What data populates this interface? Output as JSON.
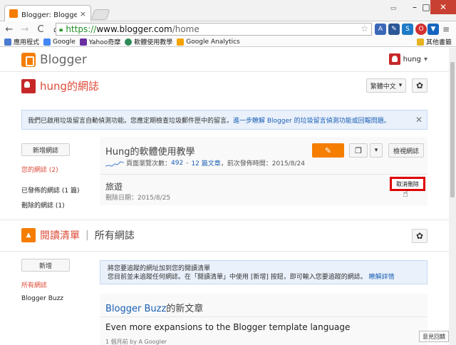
{
  "browser": {
    "tab_title": "Blogger: Blogger 資訊主",
    "tab_close": "×",
    "window_min": "–",
    "window_max": "□",
    "window_close": "✕",
    "back": "←",
    "forward": "→",
    "reload": "C",
    "home": "⌂",
    "url_scheme": "https://",
    "url_host": "www.blogger.com",
    "url_path": "/home",
    "bookmarks": [
      {
        "label": "應用程式",
        "color": "#4a7bd0"
      },
      {
        "label": "Google",
        "color": "#4285f4"
      },
      {
        "label": "Yahoo奇摩",
        "color": "#6b2fa0"
      },
      {
        "label": "軟體使用教學",
        "color": "#2e8b57"
      },
      {
        "label": "Google Analytics",
        "color": "#f4a300"
      }
    ],
    "other_bookmarks": "其他書籤"
  },
  "header": {
    "brand": "Blogger",
    "user": "hung",
    "user_caret": "▾"
  },
  "page": {
    "title": "hung的網誌",
    "lang_button": "繁體中文",
    "lang_caret": "▾",
    "gear": "✿"
  },
  "notice": {
    "text": "我們已啟用垃圾留言自動偵測功能。您應定期檢查垃圾郵件匣中的留言。",
    "link": "進一步瞭解 Blogger 的垃圾留言偵測功能或回報問題。",
    "close": "✕"
  },
  "sidebar": {
    "new_blog": "新增網誌",
    "items": [
      "您的網誌 (2)",
      "已發佈的網誌 (1 篇)",
      "刪除的網誌 (1)"
    ]
  },
  "blog": {
    "title": "Hung的軟體使用教學",
    "views_label": "頁面瀏覽次數：",
    "views": "492",
    "posts_label": "12 篇文章",
    "last_label": "，前次發佈時間：2015/8/24",
    "edit_icon": "✎",
    "copy_icon": "❐",
    "caret": "▾",
    "view_blog": "檢視網誌",
    "draft_title": "旅遊",
    "draft_meta": "刪除日期：2015/8/25",
    "undo_delete": "取消刪除",
    "cursor": "☝"
  },
  "reading_list": {
    "icon": "▲",
    "title": "閱讀清單",
    "sep": "|",
    "all": "所有網誌",
    "add": "新增",
    "side_items": [
      "所有網誌",
      "Blogger Buzz"
    ],
    "notice_line1": "將您要追蹤的網址加到您的閱讀清單",
    "notice_line2": "您目前並未追蹤任何網誌。在「閱讀清單」中使用 [新增] 按鈕，即可輸入您要追蹤的網誌。",
    "notice_link": "瞭解詳情",
    "feed_brand": "Blogger Buzz",
    "feed_suffix": "的新文章",
    "post_title": "Even more expansions to the Blogger template language",
    "post_meta": "1 個月前 by A Googler",
    "feedback": "意見回饋"
  }
}
